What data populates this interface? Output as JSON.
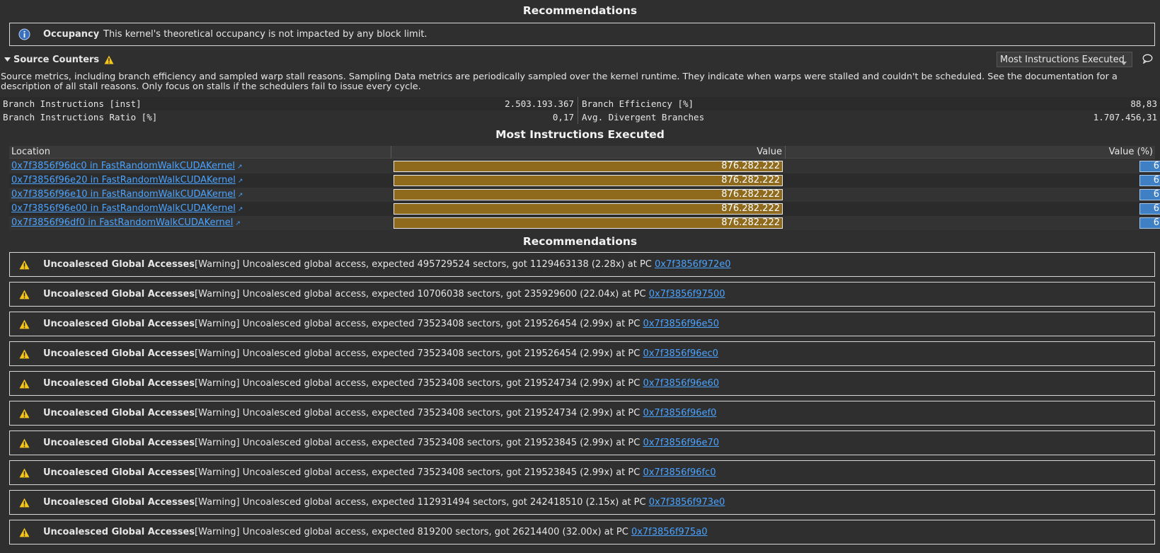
{
  "top_recommendations": {
    "title": "Recommendations",
    "occupancy": {
      "title": "Occupancy",
      "message": "This kernel's theoretical occupancy is not impacted by any block limit."
    }
  },
  "source_counters": {
    "title": "Source Counters",
    "dropdown_value": "Most Instructions Executed",
    "description": "Source metrics, including branch efficiency and sampled warp stall reasons. Sampling Data metrics are periodically sampled over the kernel runtime. They indicate when warps were stalled and couldn't be scheduled. See the documentation for a description of all stall reasons. Only focus on stalls if the schedulers fail to issue every cycle.",
    "metrics": [
      {
        "left_label": "Branch Instructions [inst]",
        "left_value": "2.503.193.367",
        "right_label": "Branch Efficiency [%]",
        "right_value": "88,83"
      },
      {
        "left_label": "Branch Instructions Ratio [%]",
        "left_value": "0,17",
        "right_label": "Avg. Divergent Branches",
        "right_value": "1.707.456,31"
      }
    ]
  },
  "most_instructions": {
    "title": "Most Instructions Executed",
    "columns": {
      "location": "Location",
      "value": "Value",
      "value_pct": "Value (%)"
    },
    "rows": [
      {
        "location": "0x7f3856f96dc0 in FastRandomWalkCUDAKernel",
        "value": "876.282.222",
        "pct": "6",
        "fill": 1.0
      },
      {
        "location": "0x7f3856f96e20 in FastRandomWalkCUDAKernel",
        "value": "876.282.222",
        "pct": "6",
        "fill": 1.0
      },
      {
        "location": "0x7f3856f96e10 in FastRandomWalkCUDAKernel",
        "value": "876.282.222",
        "pct": "6",
        "fill": 1.0
      },
      {
        "location": "0x7f3856f96e00 in FastRandomWalkCUDAKernel",
        "value": "876.282.222",
        "pct": "6",
        "fill": 1.0
      },
      {
        "location": "0x7f3856f96df0 in FastRandomWalkCUDAKernel",
        "value": "876.282.222",
        "pct": "6",
        "fill": 1.0
      }
    ]
  },
  "warnings": {
    "title": "Recommendations",
    "items": [
      {
        "title": "Uncoalesced Global Accesses",
        "message": "[Warning] Uncoalesced global access, expected 495729524 sectors, got 1129463138 (2.28x) at PC ",
        "pc": "0x7f3856f972e0"
      },
      {
        "title": "Uncoalesced Global Accesses",
        "message": "[Warning] Uncoalesced global access, expected 10706038 sectors, got 235929600 (22.04x) at PC ",
        "pc": "0x7f3856f97500"
      },
      {
        "title": "Uncoalesced Global Accesses",
        "message": "[Warning] Uncoalesced global access, expected 73523408 sectors, got 219526454 (2.99x) at PC ",
        "pc": "0x7f3856f96e50"
      },
      {
        "title": "Uncoalesced Global Accesses",
        "message": "[Warning] Uncoalesced global access, expected 73523408 sectors, got 219526454 (2.99x) at PC ",
        "pc": "0x7f3856f96ec0"
      },
      {
        "title": "Uncoalesced Global Accesses",
        "message": "[Warning] Uncoalesced global access, expected 73523408 sectors, got 219524734 (2.99x) at PC ",
        "pc": "0x7f3856f96e60"
      },
      {
        "title": "Uncoalesced Global Accesses",
        "message": "[Warning] Uncoalesced global access, expected 73523408 sectors, got 219524734 (2.99x) at PC ",
        "pc": "0x7f3856f96ef0"
      },
      {
        "title": "Uncoalesced Global Accesses",
        "message": "[Warning] Uncoalesced global access, expected 73523408 sectors, got 219523845 (2.99x) at PC ",
        "pc": "0x7f3856f96e70"
      },
      {
        "title": "Uncoalesced Global Accesses",
        "message": "[Warning] Uncoalesced global access, expected 73523408 sectors, got 219523845 (2.99x) at PC ",
        "pc": "0x7f3856f96fc0"
      },
      {
        "title": "Uncoalesced Global Accesses",
        "message": "[Warning] Uncoalesced global access, expected 112931494 sectors, got 242418510 (2.15x) at PC ",
        "pc": "0x7f3856f973e0"
      },
      {
        "title": "Uncoalesced Global Accesses",
        "message": "[Warning] Uncoalesced global access, expected 819200 sectors, got 26214400 (32.00x) at PC ",
        "pc": "0x7f3856f975a0"
      }
    ]
  },
  "icons": {
    "info": "info-icon",
    "warning": "warning-icon",
    "collapse": "collapse-triangle-icon",
    "comment": "comment-icon",
    "external": "external-link-icon"
  },
  "colors": {
    "background": "#2f2f2f",
    "link": "#4aa3ff",
    "bar_fill": "#8f6a1c",
    "pct_fill": "#3f7fc4",
    "warning": "#f5c518"
  }
}
